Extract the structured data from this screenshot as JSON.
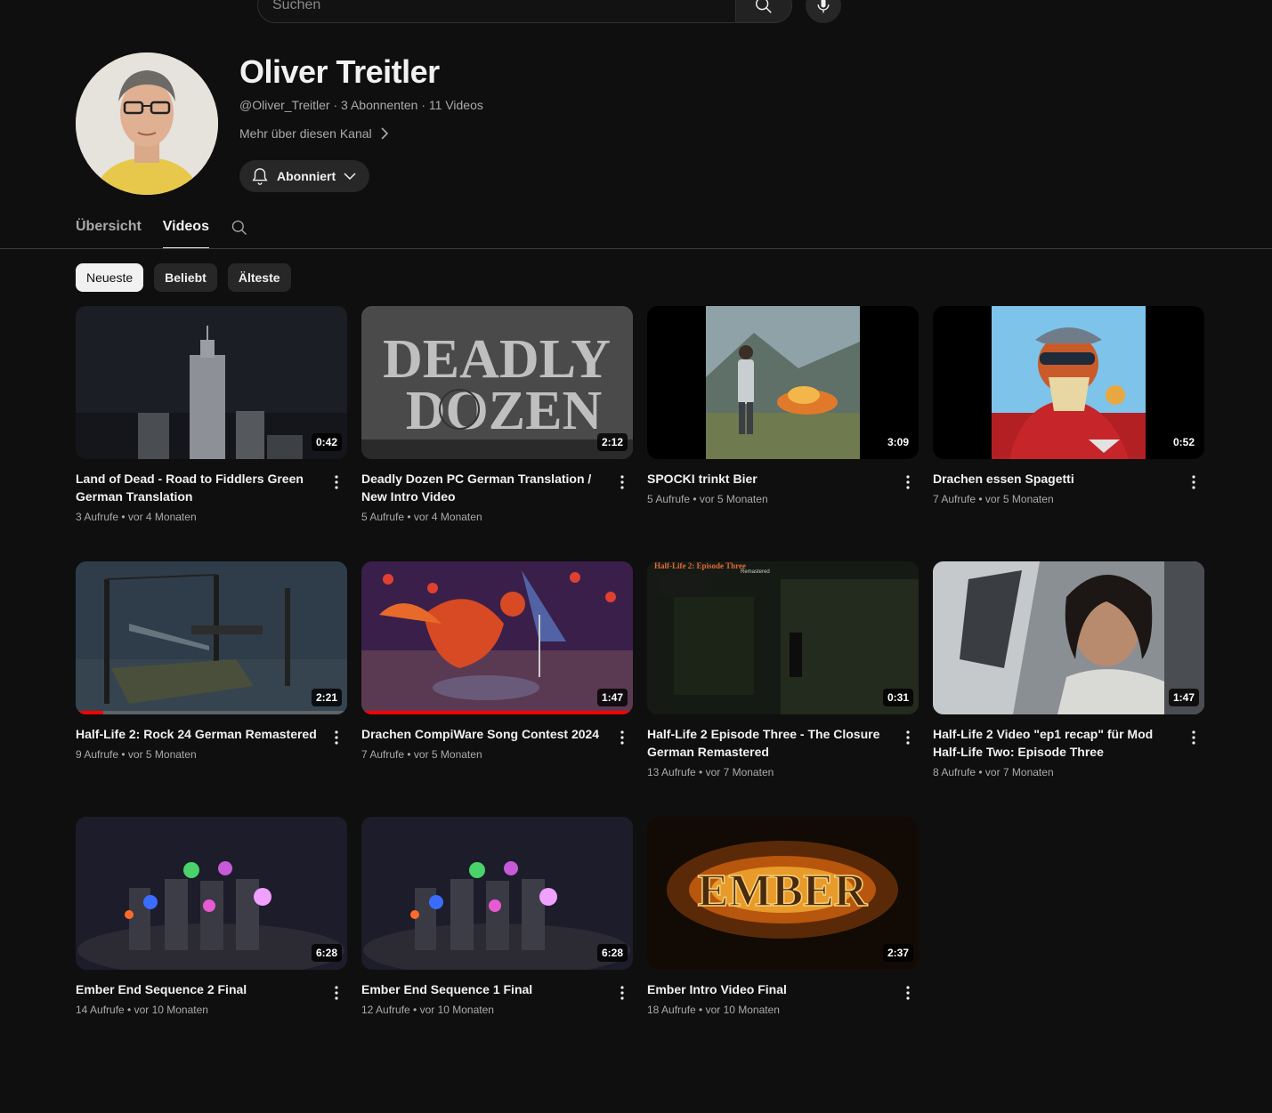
{
  "search": {
    "placeholder": "Suchen"
  },
  "channel": {
    "name": "Oliver Treitler",
    "meta": "@Oliver_Treitler · 3 Abonnenten · 11 Videos",
    "more_link": "Mehr über diesen Kanal",
    "subscribe_label": "Abonniert"
  },
  "tabs": [
    {
      "label": "Übersicht"
    },
    {
      "label": "Videos"
    }
  ],
  "chips": [
    {
      "label": "Neueste"
    },
    {
      "label": "Beliebt"
    },
    {
      "label": "Älteste"
    }
  ],
  "videos": [
    {
      "title": "Land of Dead - Road to Fiddlers Green German Translation",
      "duration": "0:42",
      "stats": "3 Aufrufe • vor 4 Monaten"
    },
    {
      "title": "Deadly Dozen PC German Translation / New Intro Video",
      "duration": "2:12",
      "stats": "5 Aufrufe • vor 4 Monaten",
      "thumb_text_1": "DEADLY",
      "thumb_text_2": "DOZEN"
    },
    {
      "title": "SPOCKI trinkt Bier",
      "duration": "3:09",
      "stats": "5 Aufrufe • vor 5 Monaten"
    },
    {
      "title": "Drachen essen Spagetti",
      "duration": "0:52",
      "stats": "7 Aufrufe • vor 5 Monaten"
    },
    {
      "title": "Half-Life 2: Rock 24 German Remastered",
      "duration": "2:21",
      "stats": "9 Aufrufe • vor 5 Monaten",
      "watched": 0.1
    },
    {
      "title": "Drachen CompiWare Song Contest 2024",
      "duration": "1:47",
      "stats": "7 Aufrufe • vor 5 Monaten",
      "watched": 1.0
    },
    {
      "title": "Half-Life 2 Episode Three - The Closure German Remastered",
      "duration": "0:31",
      "stats": "13 Aufrufe • vor 7 Monaten",
      "thumb_text_1": "Half-Life 2: Episode Three",
      "thumb_text_2": "Remastered"
    },
    {
      "title": "Half-Life 2 Video \"ep1 recap\" für Mod Half-Life Two: Episode Three",
      "duration": "1:47",
      "stats": "8 Aufrufe • vor 7 Monaten"
    },
    {
      "title": "Ember End Sequence 2 Final",
      "duration": "6:28",
      "stats": "14 Aufrufe • vor 10 Monaten"
    },
    {
      "title": "Ember End Sequence 1 Final",
      "duration": "6:28",
      "stats": "12 Aufrufe • vor 10 Monaten"
    },
    {
      "title": "Ember Intro Video Final",
      "duration": "2:37",
      "stats": "18 Aufrufe • vor 10 Monaten",
      "thumb_text_1": "EMBER"
    }
  ]
}
